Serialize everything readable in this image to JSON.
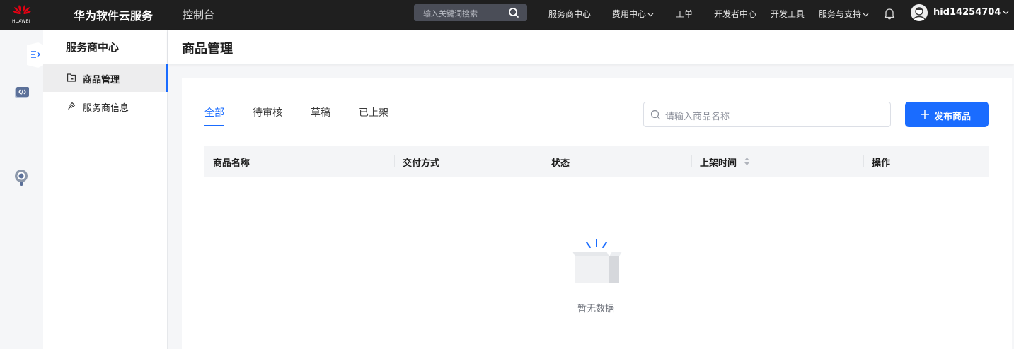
{
  "brand": {
    "logo_text": "HUAWEI",
    "title": "华为软件云服务",
    "console": "控制台"
  },
  "topbar": {
    "search_placeholder": "输入关键词搜索",
    "nav": [
      {
        "label": "服务商中心",
        "has_dropdown": false
      },
      {
        "label": "费用中心",
        "has_dropdown": true
      },
      {
        "label": "工单",
        "has_dropdown": false
      },
      {
        "label": "开发者中心",
        "has_dropdown": false
      },
      {
        "label": "开发工具",
        "has_dropdown": false
      },
      {
        "label": "服务与支持",
        "has_dropdown": true
      }
    ],
    "username": "hid14254704"
  },
  "sidemenu": {
    "title": "服务商中心",
    "items": [
      {
        "label": "商品管理",
        "icon": "folder-icon",
        "active": true
      },
      {
        "label": "服务商信息",
        "icon": "link-icon",
        "active": false
      }
    ]
  },
  "page": {
    "title": "商品管理"
  },
  "tabs": [
    {
      "label": "全部",
      "active": true
    },
    {
      "label": "待审核",
      "active": false
    },
    {
      "label": "草稿",
      "active": false
    },
    {
      "label": "已上架",
      "active": false
    }
  ],
  "product_search": {
    "placeholder": "请输入商品名称"
  },
  "publish_button": {
    "label": "发布商品"
  },
  "table": {
    "columns": [
      "商品名称",
      "交付方式",
      "状态",
      "上架时间",
      "操作"
    ],
    "rows": [],
    "empty_text": "暂无数据"
  },
  "colors": {
    "accent": "#1a6cff",
    "topbar": "#1f1f1f",
    "brand_red": "#e60012"
  }
}
